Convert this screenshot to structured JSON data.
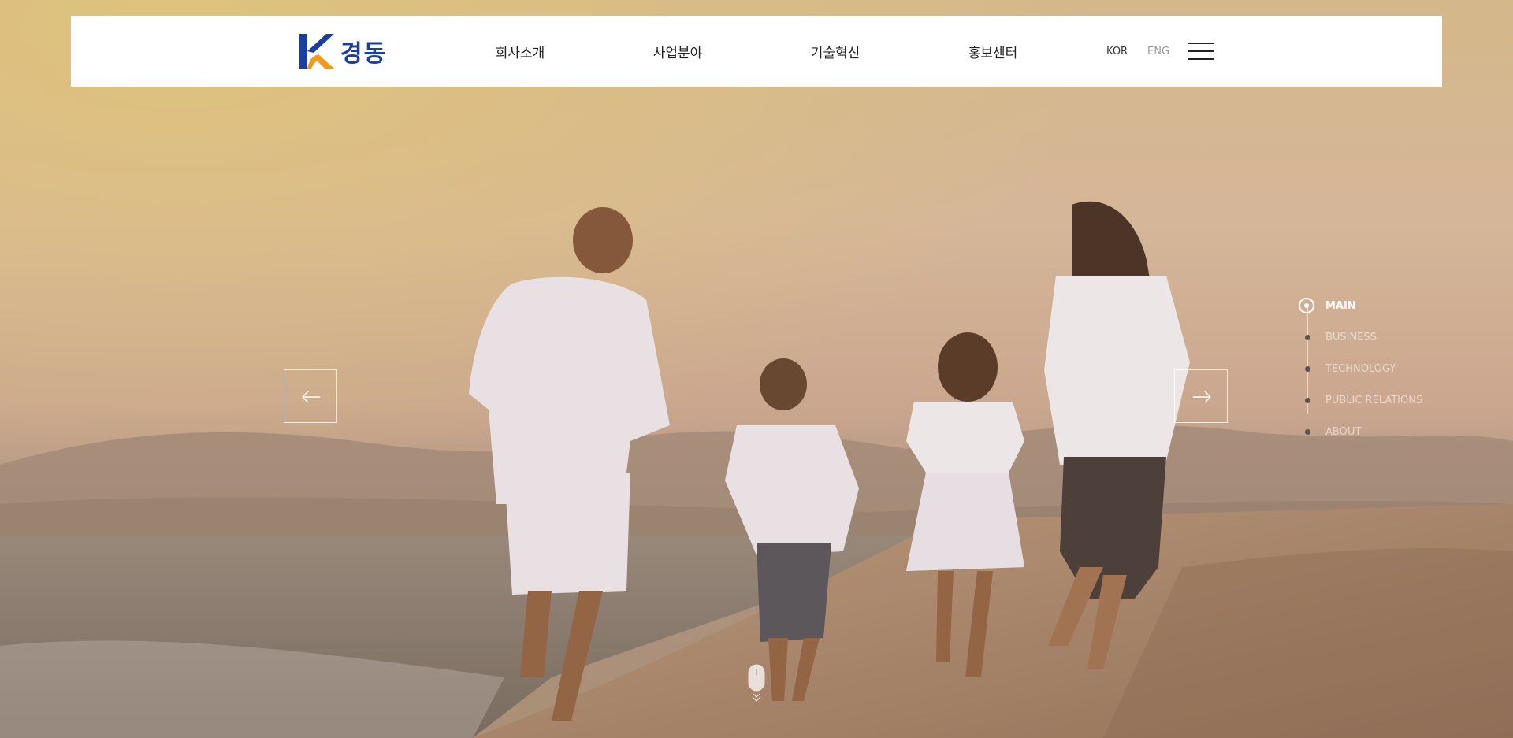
{
  "brand": {
    "name": "경동",
    "logo_letter": "K",
    "colors": {
      "primary": "#1d3f9c",
      "accent": "#f39a1e"
    }
  },
  "nav": {
    "items": [
      {
        "label": "회사소개"
      },
      {
        "label": "사업분야"
      },
      {
        "label": "기술혁신"
      },
      {
        "label": "홍보센터"
      }
    ]
  },
  "lang": {
    "kor": "KOR",
    "eng": "ENG",
    "selected": "KOR"
  },
  "hero": {
    "prev_icon": "arrow-left-icon",
    "next_icon": "arrow-right-icon"
  },
  "section_nav": {
    "items": [
      {
        "label": "MAIN",
        "active": true
      },
      {
        "label": "BUSINESS",
        "active": false
      },
      {
        "label": "TECHNOLOGY",
        "active": false
      },
      {
        "label": "PUBLIC RELATIONS",
        "active": false
      },
      {
        "label": "ABOUT",
        "active": false
      }
    ]
  },
  "scroll": {
    "icon": "mouse-icon"
  }
}
